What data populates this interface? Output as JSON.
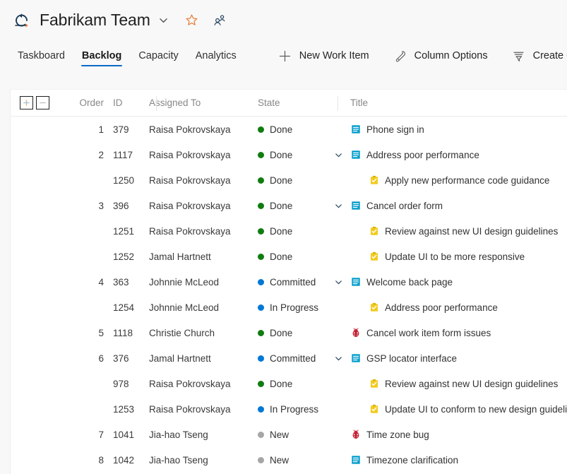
{
  "header": {
    "app_icon": "azure-boards-icon",
    "team_name": "Fabrikam Team",
    "chevron_icon": "chevron-down-icon",
    "favorite_icon": "star-icon",
    "members_icon": "team-members-icon",
    "star_color": "#e8752c",
    "icon_color": "#1b3a57"
  },
  "tabs": [
    {
      "label": "Taskboard",
      "active": false
    },
    {
      "label": "Backlog",
      "active": true
    },
    {
      "label": "Capacity",
      "active": false
    },
    {
      "label": "Analytics",
      "active": false
    }
  ],
  "toolbar": {
    "accent_color": "#0b6ac8",
    "buttons": [
      {
        "label": "New Work Item",
        "icon": "plus-icon"
      },
      {
        "label": "Column Options",
        "icon": "wrench-icon"
      },
      {
        "label": "Create Query",
        "icon": "filter-icon"
      }
    ]
  },
  "grid": {
    "expand_all_icon": "plus-box-icon",
    "collapse_all_icon": "minus-box-icon",
    "columns": [
      "Order",
      "ID",
      "Assigned To",
      "State",
      "Title"
    ],
    "state_colors": {
      "Done": "#107c10",
      "Committed": "#0078d4",
      "In Progress": "#0078d4",
      "New": "#a6a6a6"
    },
    "type_colors": {
      "story": "#009ccc",
      "task": "#f2cb1d",
      "bug": "#cc293d"
    },
    "rows": [
      {
        "order": "1",
        "id": "379",
        "assigned": "Raisa Pokrovskaya",
        "state": "Done",
        "title": "Phone sign in",
        "type": "story",
        "level": "parent",
        "expander": false
      },
      {
        "order": "2",
        "id": "1117",
        "assigned": "Raisa Pokrovskaya",
        "state": "Done",
        "title": "Address poor performance",
        "type": "story",
        "level": "parent",
        "expander": true
      },
      {
        "order": "",
        "id": "1250",
        "assigned": "Raisa Pokrovskaya",
        "state": "Done",
        "title": "Apply new performance code guidance",
        "type": "task",
        "level": "child",
        "expander": false
      },
      {
        "order": "3",
        "id": "396",
        "assigned": "Raisa Pokrovskaya",
        "state": "Done",
        "title": "Cancel order form",
        "type": "story",
        "level": "parent",
        "expander": true
      },
      {
        "order": "",
        "id": "1251",
        "assigned": "Raisa Pokrovskaya",
        "state": "Done",
        "title": "Review against new UI design guidelines",
        "type": "task",
        "level": "child",
        "expander": false
      },
      {
        "order": "",
        "id": "1252",
        "assigned": "Jamal Hartnett",
        "state": "Done",
        "title": "Update UI to be more responsive",
        "type": "task",
        "level": "child",
        "expander": false
      },
      {
        "order": "4",
        "id": "363",
        "assigned": "Johnnie McLeod",
        "state": "Committed",
        "title": "Welcome back page",
        "type": "story",
        "level": "parent",
        "expander": true
      },
      {
        "order": "",
        "id": "1254",
        "assigned": "Johnnie McLeod",
        "state": "In Progress",
        "title": "Address poor performance",
        "type": "task",
        "level": "child",
        "expander": false
      },
      {
        "order": "5",
        "id": "1118",
        "assigned": "Christie Church",
        "state": "Done",
        "title": "Cancel work item form issues",
        "type": "bug",
        "level": "parent",
        "expander": false
      },
      {
        "order": "6",
        "id": "376",
        "assigned": "Jamal Hartnett",
        "state": "Committed",
        "title": "GSP locator interface",
        "type": "story",
        "level": "parent",
        "expander": true
      },
      {
        "order": "",
        "id": "978",
        "assigned": "Raisa Pokrovskaya",
        "state": "Done",
        "title": "Review against new UI design guidelines",
        "type": "task",
        "level": "child",
        "expander": false
      },
      {
        "order": "",
        "id": "1253",
        "assigned": "Raisa Pokrovskaya",
        "state": "In Progress",
        "title": "Update UI to conform to new design guidelines",
        "type": "task",
        "level": "child",
        "expander": false
      },
      {
        "order": "7",
        "id": "1041",
        "assigned": "Jia-hao Tseng",
        "state": "New",
        "title": "Time zone bug",
        "type": "bug",
        "level": "parent",
        "expander": false
      },
      {
        "order": "8",
        "id": "1042",
        "assigned": "Jia-hao Tseng",
        "state": "New",
        "title": "Timezone clarification",
        "type": "story",
        "level": "parent",
        "expander": false
      }
    ]
  }
}
